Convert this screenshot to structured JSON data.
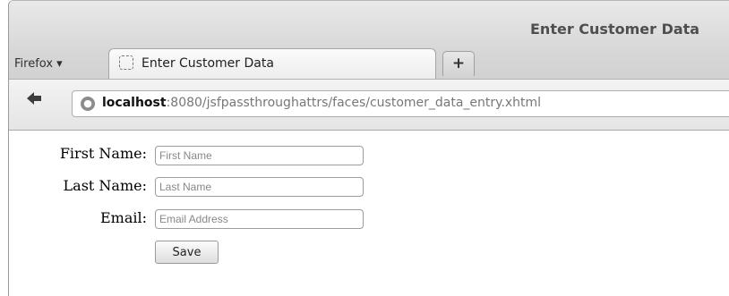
{
  "window": {
    "title": "Enter Customer Data"
  },
  "browser": {
    "menu_label": "Firefox ▾",
    "tab_label": "Enter Customer Data",
    "new_tab_label": "+",
    "back_glyph": "◆",
    "url_host": "localhost",
    "url_rest": ":8080/jsfpassthroughattrs/faces/customer_data_entry.xhtml"
  },
  "form": {
    "first_name_label": "First Name:",
    "first_name_placeholder": "First Name",
    "last_name_label": "Last Name:",
    "last_name_placeholder": "Last Name",
    "email_label": "Email:",
    "email_placeholder": "Email Address",
    "save_label": "Save"
  }
}
